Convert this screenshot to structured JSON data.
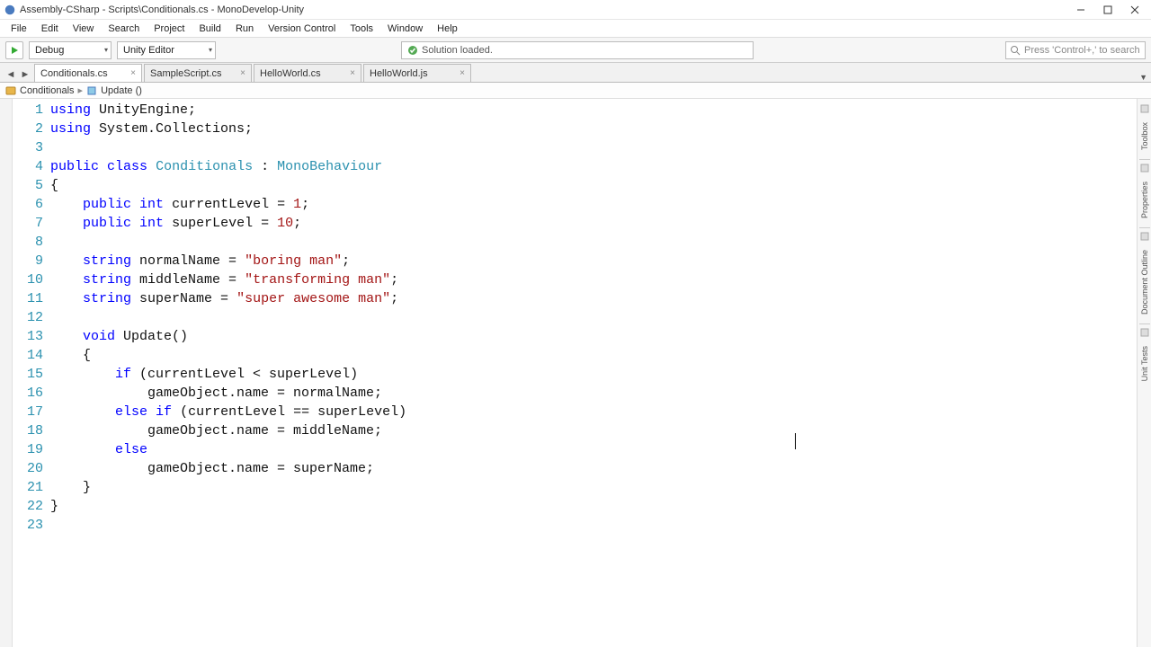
{
  "window": {
    "title": "Assembly-CSharp - Scripts\\Conditionals.cs - MonoDevelop-Unity"
  },
  "menu": {
    "items": [
      "File",
      "Edit",
      "View",
      "Search",
      "Project",
      "Build",
      "Run",
      "Version Control",
      "Tools",
      "Window",
      "Help"
    ]
  },
  "toolbar": {
    "config": "Debug",
    "target": "Unity Editor",
    "status": "Solution loaded.",
    "search_placeholder": "Press 'Control+,' to search"
  },
  "tabs": [
    {
      "label": "Conditionals.cs",
      "active": true
    },
    {
      "label": "SampleScript.cs",
      "active": false
    },
    {
      "label": "HelloWorld.cs",
      "active": false
    },
    {
      "label": "HelloWorld.js",
      "active": false
    }
  ],
  "breadcrumb": {
    "class": "Conditionals",
    "method": "Update ()"
  },
  "code": [
    {
      "n": 1,
      "t": [
        [
          "kw",
          "using"
        ],
        [
          "",
          " UnityEngine;"
        ]
      ]
    },
    {
      "n": 2,
      "t": [
        [
          "kw",
          "using"
        ],
        [
          "",
          " System.Collections;"
        ]
      ]
    },
    {
      "n": 3,
      "t": [
        [
          "",
          ""
        ]
      ]
    },
    {
      "n": 4,
      "t": [
        [
          "kw",
          "public"
        ],
        [
          "",
          " "
        ],
        [
          "kw",
          "class"
        ],
        [
          "",
          " "
        ],
        [
          "type",
          "Conditionals"
        ],
        [
          "",
          " : "
        ],
        [
          "type",
          "MonoBehaviour"
        ]
      ]
    },
    {
      "n": 5,
      "t": [
        [
          "",
          "{"
        ]
      ]
    },
    {
      "n": 6,
      "t": [
        [
          "",
          "    "
        ],
        [
          "kw",
          "public"
        ],
        [
          "",
          " "
        ],
        [
          "kw",
          "int"
        ],
        [
          "",
          " currentLevel = "
        ],
        [
          "num",
          "1"
        ],
        [
          "",
          ";"
        ]
      ]
    },
    {
      "n": 7,
      "t": [
        [
          "",
          "    "
        ],
        [
          "kw",
          "public"
        ],
        [
          "",
          " "
        ],
        [
          "kw",
          "int"
        ],
        [
          "",
          " superLevel = "
        ],
        [
          "num",
          "10"
        ],
        [
          "",
          ";"
        ]
      ]
    },
    {
      "n": 8,
      "t": [
        [
          "",
          ""
        ]
      ]
    },
    {
      "n": 9,
      "t": [
        [
          "",
          "    "
        ],
        [
          "kw",
          "string"
        ],
        [
          "",
          " normalName = "
        ],
        [
          "str",
          "\"boring man\""
        ],
        [
          "",
          ";"
        ]
      ]
    },
    {
      "n": 10,
      "t": [
        [
          "",
          "    "
        ],
        [
          "kw",
          "string"
        ],
        [
          "",
          " middleName = "
        ],
        [
          "str",
          "\"transforming man\""
        ],
        [
          "",
          ";"
        ]
      ]
    },
    {
      "n": 11,
      "t": [
        [
          "",
          "    "
        ],
        [
          "kw",
          "string"
        ],
        [
          "",
          " superName = "
        ],
        [
          "str",
          "\"super awesome man\""
        ],
        [
          "",
          ";"
        ]
      ]
    },
    {
      "n": 12,
      "t": [
        [
          "",
          ""
        ]
      ]
    },
    {
      "n": 13,
      "t": [
        [
          "",
          "    "
        ],
        [
          "kw",
          "void"
        ],
        [
          "",
          " Update()"
        ]
      ]
    },
    {
      "n": 14,
      "t": [
        [
          "",
          "    {"
        ]
      ]
    },
    {
      "n": 15,
      "t": [
        [
          "",
          "        "
        ],
        [
          "kw",
          "if"
        ],
        [
          "",
          " (currentLevel < superLevel)"
        ]
      ]
    },
    {
      "n": 16,
      "t": [
        [
          "",
          "            gameObject.name = normalName;"
        ]
      ]
    },
    {
      "n": 17,
      "t": [
        [
          "",
          "        "
        ],
        [
          "kw",
          "else"
        ],
        [
          "",
          " "
        ],
        [
          "kw",
          "if"
        ],
        [
          "",
          " (currentLevel == superLevel)"
        ]
      ]
    },
    {
      "n": 18,
      "t": [
        [
          "",
          "            gameObject.name = middleName;"
        ]
      ]
    },
    {
      "n": 19,
      "t": [
        [
          "",
          "        "
        ],
        [
          "kw",
          "else"
        ]
      ]
    },
    {
      "n": 20,
      "t": [
        [
          "",
          "            gameObject.name = superName;"
        ]
      ]
    },
    {
      "n": 21,
      "t": [
        [
          "",
          "    }"
        ]
      ]
    },
    {
      "n": 22,
      "t": [
        [
          "",
          "}"
        ]
      ]
    },
    {
      "n": 23,
      "t": [
        [
          "",
          ""
        ]
      ]
    }
  ],
  "right_rail": {
    "tabs": [
      "Toolbox",
      "Properties",
      "Document Outline",
      "Unit Tests"
    ]
  }
}
